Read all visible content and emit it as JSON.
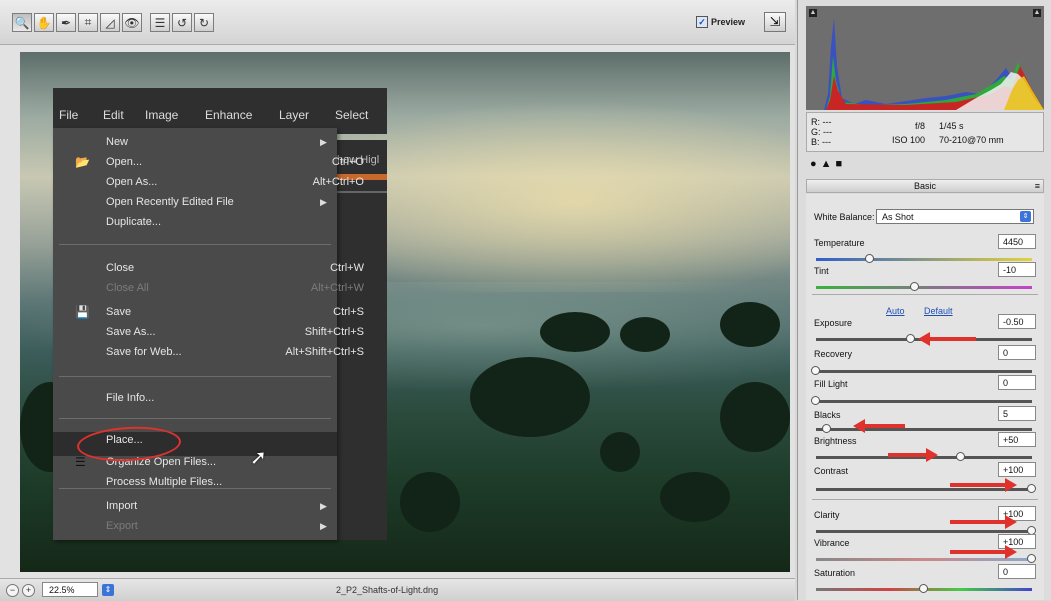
{
  "toolbar": {
    "tools": [
      {
        "icon": "zoom-icon",
        "glyph": "🔍"
      },
      {
        "icon": "hand-icon",
        "glyph": "✋"
      },
      {
        "icon": "eyedropper-icon",
        "glyph": "✒"
      },
      {
        "icon": "crop-icon",
        "glyph": "⌗"
      },
      {
        "icon": "straighten-icon",
        "glyph": "◿"
      },
      {
        "icon": "redeye-icon",
        "glyph": "👁"
      },
      {
        "icon": "preferences-icon",
        "glyph": "☰"
      },
      {
        "icon": "rotate-left-icon",
        "glyph": "↺"
      },
      {
        "icon": "rotate-right-icon",
        "glyph": "↻"
      }
    ],
    "preview_label": "Preview",
    "preview_checked": true
  },
  "menubar": {
    "items": [
      "File",
      "Edit",
      "Image",
      "Enhance",
      "Layer",
      "Select"
    ]
  },
  "file_menu": {
    "items": [
      {
        "label": "New",
        "shortcut": "",
        "submenu": true,
        "dim": false,
        "icon": ""
      },
      {
        "label": "Open...",
        "shortcut": "Ctrl+O",
        "submenu": false,
        "dim": false,
        "icon": "folder"
      },
      {
        "label": "Open As...",
        "shortcut": "Alt+Ctrl+O",
        "submenu": false,
        "dim": false,
        "icon": ""
      },
      {
        "label": "Open Recently Edited File",
        "shortcut": "",
        "submenu": true,
        "dim": false,
        "icon": ""
      },
      {
        "label": "Duplicate...",
        "shortcut": "",
        "submenu": false,
        "dim": false,
        "icon": ""
      },
      {
        "label": "Close",
        "shortcut": "Ctrl+W",
        "submenu": false,
        "dim": false,
        "icon": ""
      },
      {
        "label": "Close All",
        "shortcut": "Alt+Ctrl+W",
        "submenu": false,
        "dim": true,
        "icon": ""
      },
      {
        "label": "Save",
        "shortcut": "Ctrl+S",
        "submenu": false,
        "dim": false,
        "icon": "disk"
      },
      {
        "label": "Save As...",
        "shortcut": "Shift+Ctrl+S",
        "submenu": false,
        "dim": false,
        "icon": ""
      },
      {
        "label": "Save for Web...",
        "shortcut": "Alt+Shift+Ctrl+S",
        "submenu": false,
        "dim": false,
        "icon": ""
      },
      {
        "label": "File Info...",
        "shortcut": "",
        "submenu": false,
        "dim": false,
        "icon": ""
      },
      {
        "label": "Place...",
        "shortcut": "",
        "submenu": false,
        "dim": false,
        "icon": ""
      },
      {
        "label": "Organize Open Files...",
        "shortcut": "",
        "submenu": false,
        "dim": false,
        "icon": "organize"
      },
      {
        "label": "Process Multiple Files...",
        "shortcut": "",
        "submenu": false,
        "dim": false,
        "icon": ""
      },
      {
        "label": "Import",
        "shortcut": "",
        "submenu": true,
        "dim": false,
        "icon": ""
      },
      {
        "label": "Export",
        "shortcut": "",
        "submenu": true,
        "dim": true,
        "icon": ""
      }
    ],
    "partial_behind": "how Higl"
  },
  "status": {
    "zoom": "22.5%",
    "filename": "2_P2_Shafts-of-Light.dng"
  },
  "camera_info": {
    "r": "R:  ---",
    "g": "G:  ---",
    "b": "B:  ---",
    "aperture": "f/8",
    "shutter": "1/45 s",
    "iso": "ISO 100",
    "lens": "70-210@70 mm"
  },
  "panel": {
    "header": "Basic",
    "white_balance_label": "White Balance:",
    "white_balance_value": "As Shot",
    "auto_link": "Auto",
    "default_link": "Default"
  },
  "sliders": [
    {
      "name": "temperature",
      "label": "Temperature",
      "value": "4450",
      "pos": 0.25
    },
    {
      "name": "tint",
      "label": "Tint",
      "value": "-10",
      "pos": 0.46
    },
    {
      "name": "exposure",
      "label": "Exposure",
      "value": "-0.50",
      "pos": 0.44
    },
    {
      "name": "recovery",
      "label": "Recovery",
      "value": "0",
      "pos": 0.0
    },
    {
      "name": "fill-light",
      "label": "Fill Light",
      "value": "0",
      "pos": 0.0
    },
    {
      "name": "blacks",
      "label": "Blacks",
      "value": "5",
      "pos": 0.05
    },
    {
      "name": "brightness",
      "label": "Brightness",
      "value": "+50",
      "pos": 0.67
    },
    {
      "name": "contrast",
      "label": "Contrast",
      "value": "+100",
      "pos": 1.0
    },
    {
      "name": "clarity",
      "label": "Clarity",
      "value": "+100",
      "pos": 1.0
    },
    {
      "name": "vibrance",
      "label": "Vibrance",
      "value": "+100",
      "pos": 1.0
    },
    {
      "name": "saturation",
      "label": "Saturation",
      "value": "0",
      "pos": 0.5
    }
  ],
  "colors": {
    "annotation": "#e0322d",
    "accent": "#3b73d9"
  }
}
